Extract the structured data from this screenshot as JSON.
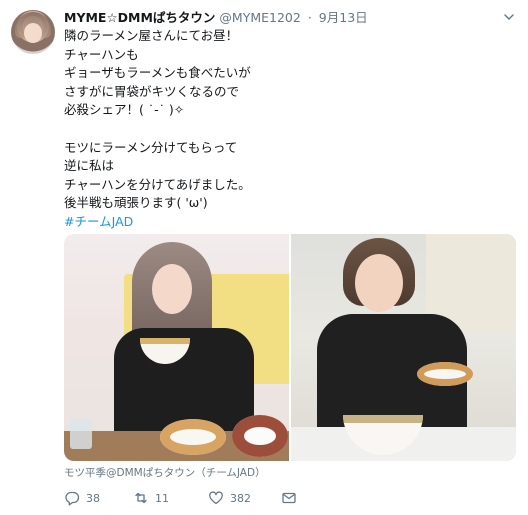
{
  "tweet": {
    "author": {
      "name": "MYME☆DMMぱちタウン",
      "handle": "@MYME1202",
      "separator": "·",
      "date": "9月13日"
    },
    "menu_icon": "chevron-down-icon",
    "text_lines": [
      "隣のラーメン屋さんにてお昼！",
      "チャーハンも",
      "ギョーザもラーメンも食べたいが",
      "さすがに胃袋がキツくなるので",
      "必殺シェア！( ˙-˙ )✧",
      "",
      "モツにラーメン分けてもらって",
      "逆に私は",
      "チャーハンを分けてあげました。",
      "後半戦も頑張ります( 'ω')"
    ],
    "hashtag": "#チームJAD",
    "media_caption": "モツ平季@DMMぱちタウン（チームJAD）",
    "actions": {
      "reply_count": "38",
      "retweet_count": "11",
      "like_count": "382"
    },
    "colors": {
      "text": "#14171a",
      "secondary": "#657786",
      "link": "#1b95e0"
    }
  }
}
